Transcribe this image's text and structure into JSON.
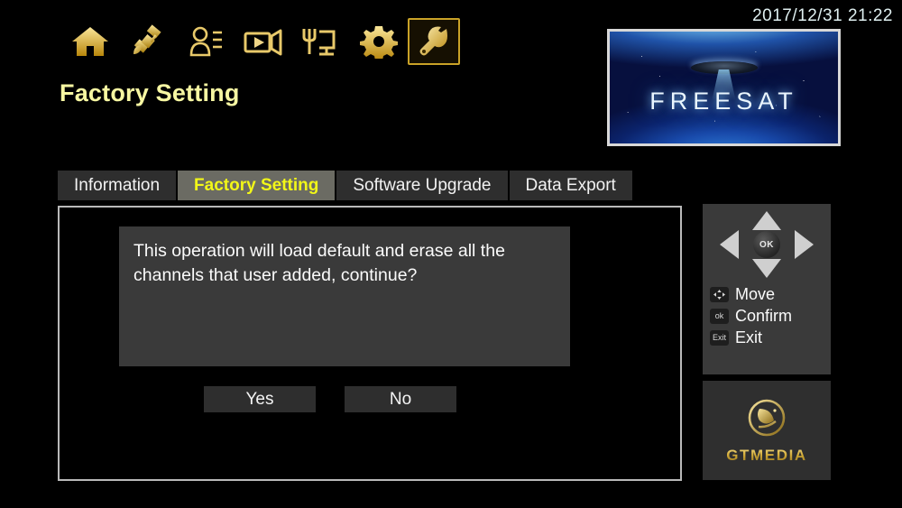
{
  "statusbar": {
    "datetime": "2017/12/31  21:22"
  },
  "iconbar": {
    "items": [
      {
        "name": "home-icon",
        "label": "Home",
        "selected": false
      },
      {
        "name": "satellite-icon",
        "label": "Installation",
        "selected": false
      },
      {
        "name": "user-list-icon",
        "label": "Channel",
        "selected": false
      },
      {
        "name": "video-camera-icon",
        "label": "Media",
        "selected": false
      },
      {
        "name": "monitor-fork-icon",
        "label": "Network",
        "selected": false
      },
      {
        "name": "gear-icon",
        "label": "Settings",
        "selected": false
      },
      {
        "name": "wrench-icon",
        "label": "Tools",
        "selected": true
      }
    ]
  },
  "header": {
    "title": "Factory Setting"
  },
  "preview": {
    "brand_text": "FREESAT"
  },
  "tabs": [
    {
      "label": "Information",
      "active": false
    },
    {
      "label": "Factory Setting",
      "active": true
    },
    {
      "label": "Software Upgrade",
      "active": false
    },
    {
      "label": "Data Export",
      "active": false
    }
  ],
  "dialog": {
    "message": "This operation will load default and erase all the channels that user added, continue?",
    "yes_label": "Yes",
    "no_label": "No"
  },
  "help": {
    "legend": [
      {
        "badge": "arrows",
        "badge_text": "",
        "label": "Move"
      },
      {
        "badge": "ok",
        "badge_text": "ok",
        "label": "Confirm"
      },
      {
        "badge": "exit",
        "badge_text": "Exit",
        "label": "Exit"
      }
    ],
    "ok_label": "OK"
  },
  "brand": {
    "name": "GTMEDIA"
  },
  "colors": {
    "accent_gold": "#d4ad3a",
    "title_yellow": "#f7f7a2",
    "tab_active_text": "#f2f718",
    "tab_active_bg": "#6b6b63",
    "tab_bg": "#2e2e2e",
    "panel_bg": "#3a3a3a",
    "background": "#000000",
    "clock_text": "#dfeff0"
  }
}
